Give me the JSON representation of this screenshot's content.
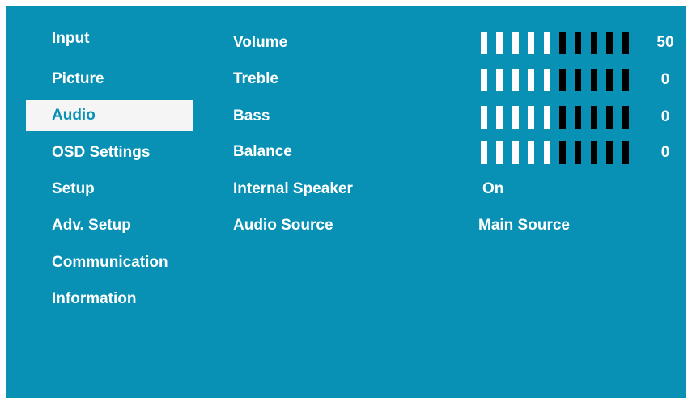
{
  "menu": {
    "items": [
      {
        "label": "Input"
      },
      {
        "label": "Picture"
      },
      {
        "label": "Audio"
      },
      {
        "label": "OSD Settings"
      },
      {
        "label": "Setup"
      },
      {
        "label": "Adv. Setup"
      },
      {
        "label": "Communication"
      },
      {
        "label": "Information"
      }
    ],
    "selected": "Audio"
  },
  "audio": {
    "volume": {
      "label": "Volume",
      "value": "50",
      "segments_on": 5,
      "segments_total": 10
    },
    "treble": {
      "label": "Treble",
      "value": "0",
      "segments_on": 5,
      "segments_total": 10
    },
    "bass": {
      "label": "Bass",
      "value": "0",
      "segments_on": 5,
      "segments_total": 10
    },
    "balance": {
      "label": "Balance",
      "value": "0",
      "segments_on": 5,
      "segments_total": 10
    },
    "internal_speaker": {
      "label": "Internal Speaker",
      "value": "On"
    },
    "audio_source": {
      "label": "Audio Source",
      "value": "Main Source"
    }
  },
  "colors": {
    "background": "#0891b5",
    "highlight": "#f5f5f5",
    "text": "#ffffff",
    "segment_on": "#ffffff",
    "segment_off": "#000000"
  }
}
